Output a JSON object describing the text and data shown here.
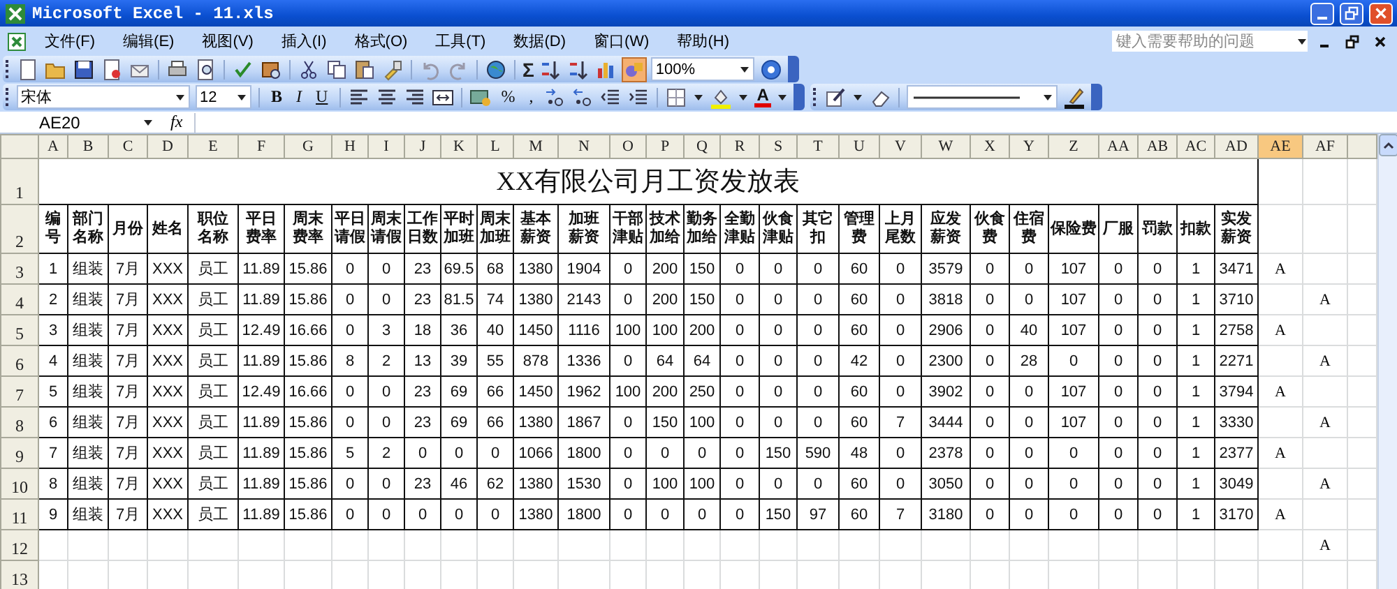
{
  "window": {
    "title": "Microsoft Excel - 11.xls"
  },
  "menu": [
    {
      "label": "文件(F)"
    },
    {
      "label": "编辑(E)"
    },
    {
      "label": "视图(V)"
    },
    {
      "label": "插入(I)"
    },
    {
      "label": "格式(O)"
    },
    {
      "label": "工具(T)"
    },
    {
      "label": "数据(D)"
    },
    {
      "label": "窗口(W)"
    },
    {
      "label": "帮助(H)"
    }
  ],
  "help_search": {
    "placeholder": "键入需要帮助的问题"
  },
  "standard_toolbar": {
    "sum_symbol": "Σ",
    "zoom": "100%"
  },
  "formatting_toolbar": {
    "font": "宋体",
    "size": "12",
    "style_buttons": [
      "B",
      "I",
      "U"
    ],
    "percent": "%",
    "comma": ",",
    "font_color_letter": "A"
  },
  "formula_bar": {
    "name_box": "AE20",
    "function_label": "fx"
  },
  "sheet": {
    "columns": [
      {
        "label": "A",
        "selected": false
      },
      {
        "label": "B",
        "selected": false
      },
      {
        "label": "C",
        "selected": false
      },
      {
        "label": "D",
        "selected": false
      },
      {
        "label": "E",
        "selected": false
      },
      {
        "label": "F",
        "selected": false
      },
      {
        "label": "G",
        "selected": false
      },
      {
        "label": "H",
        "selected": false
      },
      {
        "label": "I",
        "selected": false
      },
      {
        "label": "J",
        "selected": false
      },
      {
        "label": "K",
        "selected": false
      },
      {
        "label": "L",
        "selected": false
      },
      {
        "label": "M",
        "selected": false
      },
      {
        "label": "N",
        "selected": false
      },
      {
        "label": "O",
        "selected": false
      },
      {
        "label": "P",
        "selected": false
      },
      {
        "label": "Q",
        "selected": false
      },
      {
        "label": "R",
        "selected": false
      },
      {
        "label": "S",
        "selected": false
      },
      {
        "label": "T",
        "selected": false
      },
      {
        "label": "U",
        "selected": false
      },
      {
        "label": "V",
        "selected": false
      },
      {
        "label": "W",
        "selected": false
      },
      {
        "label": "X",
        "selected": false
      },
      {
        "label": "Y",
        "selected": false
      },
      {
        "label": "Z",
        "selected": false
      },
      {
        "label": "AA",
        "selected": false
      },
      {
        "label": "AB",
        "selected": false
      },
      {
        "label": "AC",
        "selected": false
      },
      {
        "label": "AD",
        "selected": false
      },
      {
        "label": "AE",
        "selected": true
      },
      {
        "label": "AF",
        "selected": false
      }
    ],
    "title_row": {
      "n": "1",
      "title": "XX有限公司月工资发放表"
    },
    "header_row": {
      "n": "2",
      "headers": [
        "编号",
        "部门名称",
        "月份",
        "姓名",
        "职位名称",
        "平日费率",
        "周末费率",
        "平日请假",
        "周末请假",
        "工作日数",
        "平时加班",
        "周末加班",
        "基本薪资",
        "加班薪资",
        "干部津贴",
        "技术加给",
        "勤务加给",
        "全勤津贴",
        "伙食津贴",
        "其它扣",
        "管理费",
        "上月尾数",
        "应发薪资",
        "伙食费",
        "住宿费",
        "保险费",
        "厂服",
        "罚款",
        "扣款",
        "实发薪资"
      ]
    },
    "body": [
      {
        "n": "3",
        "cells": [
          "1",
          "组装",
          "7月",
          "XXX",
          "员工",
          "11.89",
          "15.86",
          "0",
          "0",
          "23",
          "69.5",
          "68",
          "1380",
          "1904",
          "0",
          "200",
          "150",
          "0",
          "0",
          "0",
          "60",
          "0",
          "3579",
          "0",
          "0",
          "107",
          "0",
          "0",
          "1",
          "3471"
        ],
        "ae": "A"
      },
      {
        "n": "4",
        "cells": [
          "2",
          "组装",
          "7月",
          "XXX",
          "员工",
          "11.89",
          "15.86",
          "0",
          "0",
          "23",
          "81.5",
          "74",
          "1380",
          "2143",
          "0",
          "200",
          "150",
          "0",
          "0",
          "0",
          "60",
          "0",
          "3818",
          "0",
          "0",
          "107",
          "0",
          "0",
          "1",
          "3710"
        ],
        "af": "A"
      },
      {
        "n": "5",
        "cells": [
          "3",
          "组装",
          "7月",
          "XXX",
          "员工",
          "12.49",
          "16.66",
          "0",
          "3",
          "18",
          "36",
          "40",
          "1450",
          "1116",
          "100",
          "100",
          "200",
          "0",
          "0",
          "0",
          "60",
          "0",
          "2906",
          "0",
          "40",
          "107",
          "0",
          "0",
          "1",
          "2758"
        ],
        "ae": "A"
      },
      {
        "n": "6",
        "cells": [
          "4",
          "组装",
          "7月",
          "XXX",
          "员工",
          "11.89",
          "15.86",
          "8",
          "2",
          "13",
          "39",
          "55",
          "878",
          "1336",
          "0",
          "64",
          "64",
          "0",
          "0",
          "0",
          "42",
          "0",
          "2300",
          "0",
          "28",
          "0",
          "0",
          "0",
          "1",
          "2271"
        ],
        "af": "A"
      },
      {
        "n": "7",
        "cells": [
          "5",
          "组装",
          "7月",
          "XXX",
          "员工",
          "12.49",
          "16.66",
          "0",
          "0",
          "23",
          "69",
          "66",
          "1450",
          "1962",
          "100",
          "200",
          "250",
          "0",
          "0",
          "0",
          "60",
          "0",
          "3902",
          "0",
          "0",
          "107",
          "0",
          "0",
          "1",
          "3794"
        ],
        "ae": "A"
      },
      {
        "n": "8",
        "cells": [
          "6",
          "组装",
          "7月",
          "XXX",
          "员工",
          "11.89",
          "15.86",
          "0",
          "0",
          "23",
          "69",
          "66",
          "1380",
          "1867",
          "0",
          "150",
          "100",
          "0",
          "0",
          "0",
          "60",
          "7",
          "3444",
          "0",
          "0",
          "107",
          "0",
          "0",
          "1",
          "3330"
        ],
        "af": "A"
      },
      {
        "n": "9",
        "cells": [
          "7",
          "组装",
          "7月",
          "XXX",
          "员工",
          "11.89",
          "15.86",
          "5",
          "2",
          "0",
          "0",
          "0",
          "1066",
          "1800",
          "0",
          "0",
          "0",
          "0",
          "150",
          "590",
          "48",
          "0",
          "2378",
          "0",
          "0",
          "0",
          "0",
          "0",
          "1",
          "2377"
        ],
        "ae": "A"
      },
      {
        "n": "10",
        "cells": [
          "8",
          "组装",
          "7月",
          "XXX",
          "员工",
          "11.89",
          "15.86",
          "0",
          "0",
          "23",
          "46",
          "62",
          "1380",
          "1530",
          "0",
          "100",
          "100",
          "0",
          "0",
          "0",
          "60",
          "0",
          "3050",
          "0",
          "0",
          "0",
          "0",
          "0",
          "1",
          "3049"
        ],
        "af": "A"
      },
      {
        "n": "11",
        "cells": [
          "9",
          "组装",
          "7月",
          "XXX",
          "员工",
          "11.89",
          "15.86",
          "0",
          "0",
          "0",
          "0",
          "0",
          "1380",
          "1800",
          "0",
          "0",
          "0",
          "0",
          "150",
          "97",
          "60",
          "7",
          "3180",
          "0",
          "0",
          "0",
          "0",
          "0",
          "1",
          "3170"
        ],
        "ae": "A"
      },
      {
        "n": "12",
        "af": "A"
      },
      {
        "n": "13"
      }
    ]
  }
}
